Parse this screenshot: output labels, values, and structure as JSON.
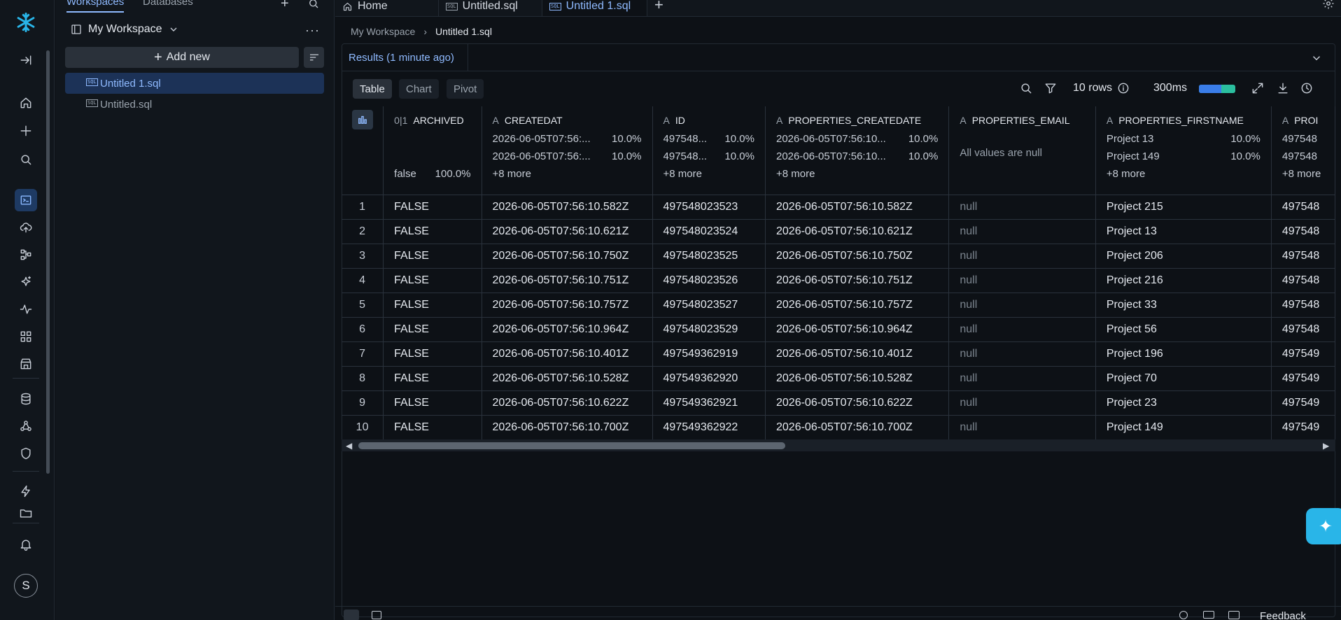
{
  "sidebar": {
    "tabs": [
      "Workspaces",
      "Databases"
    ],
    "workspace": "My Workspace",
    "add_new": "Add new",
    "files": [
      "Untitled 1.sql",
      "Untitled.sql"
    ]
  },
  "rail": {
    "avatar": "S"
  },
  "tabs": [
    {
      "label": "Home"
    },
    {
      "label": "Untitled.sql"
    },
    {
      "label": "Untitled 1.sql"
    }
  ],
  "breadcrumb": {
    "root": "My Workspace",
    "current": "Untitled 1.sql"
  },
  "results": {
    "label": "Results (1 minute ago)",
    "views": [
      "Table",
      "Chart",
      "Pivot"
    ],
    "rows": "10 rows",
    "time": "300ms",
    "time_bar_fraction": 0.62
  },
  "columns": [
    {
      "name": "ARCHIVED",
      "type": "0|1",
      "dist": [],
      "single": {
        "v": "false",
        "p": "100.0%"
      }
    },
    {
      "name": "CREATEDAT",
      "type": "A",
      "dist": [
        {
          "v": "2026-06-05T07:56:...",
          "p": "10.0%"
        },
        {
          "v": "2026-06-05T07:56:...",
          "p": "10.0%"
        }
      ],
      "more": "+8 more"
    },
    {
      "name": "ID",
      "type": "A",
      "dist": [
        {
          "v": "497548...",
          "p": "10.0%"
        },
        {
          "v": "497548...",
          "p": "10.0%"
        }
      ],
      "more": "+8 more"
    },
    {
      "name": "PROPERTIES_CREATEDATE",
      "type": "A",
      "dist": [
        {
          "v": "2026-06-05T07:56:10...",
          "p": "10.0%"
        },
        {
          "v": "2026-06-05T07:56:10...",
          "p": "10.0%"
        }
      ],
      "more": "+8 more"
    },
    {
      "name": "PROPERTIES_EMAIL",
      "type": "A",
      "dist": [],
      "note": "All values are null"
    },
    {
      "name": "PROPERTIES_FIRSTNAME",
      "type": "A",
      "dist": [
        {
          "v": "Project 13",
          "p": "10.0%"
        },
        {
          "v": "Project 149",
          "p": "10.0%"
        }
      ],
      "more": "+8 more"
    },
    {
      "name": "PROI",
      "type": "A",
      "dist": [
        {
          "v": "497548",
          "p": ""
        },
        {
          "v": "497548",
          "p": ""
        }
      ],
      "more": "+8 more"
    }
  ],
  "rows": [
    [
      "1",
      "FALSE",
      "2026-06-05T07:56:10.582Z",
      "497548023523",
      "2026-06-05T07:56:10.582Z",
      "null",
      "Project 215",
      "497548"
    ],
    [
      "2",
      "FALSE",
      "2026-06-05T07:56:10.621Z",
      "497548023524",
      "2026-06-05T07:56:10.621Z",
      "null",
      "Project 13",
      "497548"
    ],
    [
      "3",
      "FALSE",
      "2026-06-05T07:56:10.750Z",
      "497548023525",
      "2026-06-05T07:56:10.750Z",
      "null",
      "Project 206",
      "497548"
    ],
    [
      "4",
      "FALSE",
      "2026-06-05T07:56:10.751Z",
      "497548023526",
      "2026-06-05T07:56:10.751Z",
      "null",
      "Project 216",
      "497548"
    ],
    [
      "5",
      "FALSE",
      "2026-06-05T07:56:10.757Z",
      "497548023527",
      "2026-06-05T07:56:10.757Z",
      "null",
      "Project 33",
      "497548"
    ],
    [
      "6",
      "FALSE",
      "2026-06-05T07:56:10.964Z",
      "497548023529",
      "2026-06-05T07:56:10.964Z",
      "null",
      "Project 56",
      "497548"
    ],
    [
      "7",
      "FALSE",
      "2026-06-05T07:56:10.401Z",
      "497549362919",
      "2026-06-05T07:56:10.401Z",
      "null",
      "Project 196",
      "497549"
    ],
    [
      "8",
      "FALSE",
      "2026-06-05T07:56:10.528Z",
      "497549362920",
      "2026-06-05T07:56:10.528Z",
      "null",
      "Project 70",
      "497549"
    ],
    [
      "9",
      "FALSE",
      "2026-06-05T07:56:10.622Z",
      "497549362921",
      "2026-06-05T07:56:10.622Z",
      "null",
      "Project 23",
      "497549"
    ],
    [
      "10",
      "FALSE",
      "2026-06-05T07:56:10.700Z",
      "497549362922",
      "2026-06-05T07:56:10.700Z",
      "null",
      "Project 149",
      "497549"
    ]
  ],
  "footer": {
    "feedback": "Feedback"
  },
  "colors": {
    "accent": "#8fbaff",
    "brand": "#29b5e8"
  }
}
